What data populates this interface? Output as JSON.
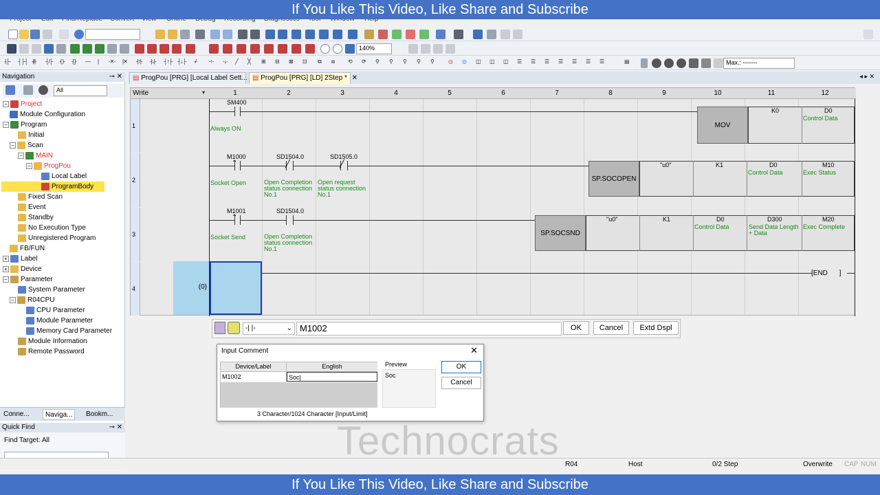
{
  "banner": {
    "top": "If You Like This Video, Like Share and Subscribe",
    "bottom": "If You Like This Video, Like Share and Subscribe"
  },
  "menu": [
    "Project",
    "Edit",
    "Find/Replace",
    "Convert",
    "View",
    "Online",
    "Debug",
    "Recording",
    "Diagnostics",
    "Tool",
    "Window",
    "Help"
  ],
  "toolbar": {
    "zoom": "140%",
    "max_label": "Max.: -------"
  },
  "navigation": {
    "title": "Navigation",
    "filter": "All",
    "tree": [
      {
        "label": "Project",
        "red": true
      },
      {
        "label": "Module Configuration"
      },
      {
        "label": "Program"
      },
      {
        "label": "Initial"
      },
      {
        "label": "Scan"
      },
      {
        "label": "MAIN",
        "red": true
      },
      {
        "label": "ProgPou",
        "red": true
      },
      {
        "label": "Local Label"
      },
      {
        "label": "ProgramBody",
        "selected": true
      },
      {
        "label": "Fixed Scan"
      },
      {
        "label": "Event"
      },
      {
        "label": "Standby"
      },
      {
        "label": "No Execution Type"
      },
      {
        "label": "Unregistered Program"
      },
      {
        "label": "FB/FUN"
      },
      {
        "label": "Label"
      },
      {
        "label": "Device"
      },
      {
        "label": "Parameter"
      },
      {
        "label": "System Parameter"
      },
      {
        "label": "R04CPU"
      },
      {
        "label": "CPU Parameter"
      },
      {
        "label": "Module Parameter"
      },
      {
        "label": "Memory Card Parameter"
      },
      {
        "label": "Module Information"
      },
      {
        "label": "Remote Password"
      }
    ],
    "bottom_tabs": [
      "Conne...",
      "Naviga...",
      "Bookm..."
    ]
  },
  "quickfind": {
    "title": "Quick Find",
    "target": "Find Target: All"
  },
  "doc_tabs": [
    "ProgPou [PRG] [Local Label Sett...",
    "ProgPou [PRG] [LD] 2Step *"
  ],
  "editor": {
    "mode": "Write",
    "columns": [
      "1",
      "2",
      "3",
      "4",
      "5",
      "6",
      "7",
      "8",
      "9",
      "10",
      "11",
      "12"
    ],
    "rows": [
      "1",
      "2",
      "3",
      "4"
    ],
    "step_label": "(0)",
    "rung1": {
      "contact": "SM400",
      "comment": "Always ON",
      "instr": "MOV",
      "op1": "K0",
      "op2": "D0",
      "op2_comment": "Control Data"
    },
    "rung2": {
      "c1": "M1000",
      "c1_comment": "Socket Open",
      "c2": "SD1504.0",
      "c2_comment": "Open Completion status connection No.1",
      "c3": "SD1505.0",
      "c3_comment": "Open request status connection No.1",
      "instr": "SP.SOCOPEN",
      "op1": "\"u0\"",
      "op2": "K1",
      "op3": "D0",
      "op3_comment": "Control Data",
      "op4": "M10",
      "op4_comment": "Exec Status"
    },
    "rung3": {
      "c1": "M1001",
      "c1_comment": "Socket Send",
      "c2": "SD1504.0",
      "c2_comment": "Open Completion status connection No.1",
      "instr": "SP.SOCSND",
      "op1": "\"u0\"",
      "op2": "K1",
      "op3": "D0",
      "op3_comment": "Control Data",
      "op4": "D300",
      "op4_comment": "Send Data Length + Data",
      "op5": "M20",
      "op5_comment": "Exec Complete"
    },
    "end_label": "END"
  },
  "inputbar": {
    "contact_symbol": "-|  |-",
    "value": "M1002",
    "ok": "OK",
    "cancel": "Cancel",
    "extd": "Extd Dspl"
  },
  "dialog": {
    "title": "Input Comment",
    "col_device": "Device/Label",
    "col_english": "English",
    "device": "M1002",
    "comment": "Soc",
    "preview_label": "Preview",
    "preview_text": "Soc",
    "ok": "OK",
    "cancel": "Cancel",
    "limit": "3 Character/1024 Character [Input/Limit]"
  },
  "watermark": "Technocrats",
  "status": {
    "cpu": "R04",
    "host": "Host",
    "step": "0/2 Step",
    "overwrite": "Overwrite",
    "cap": "CAP",
    "num": "NUM"
  }
}
